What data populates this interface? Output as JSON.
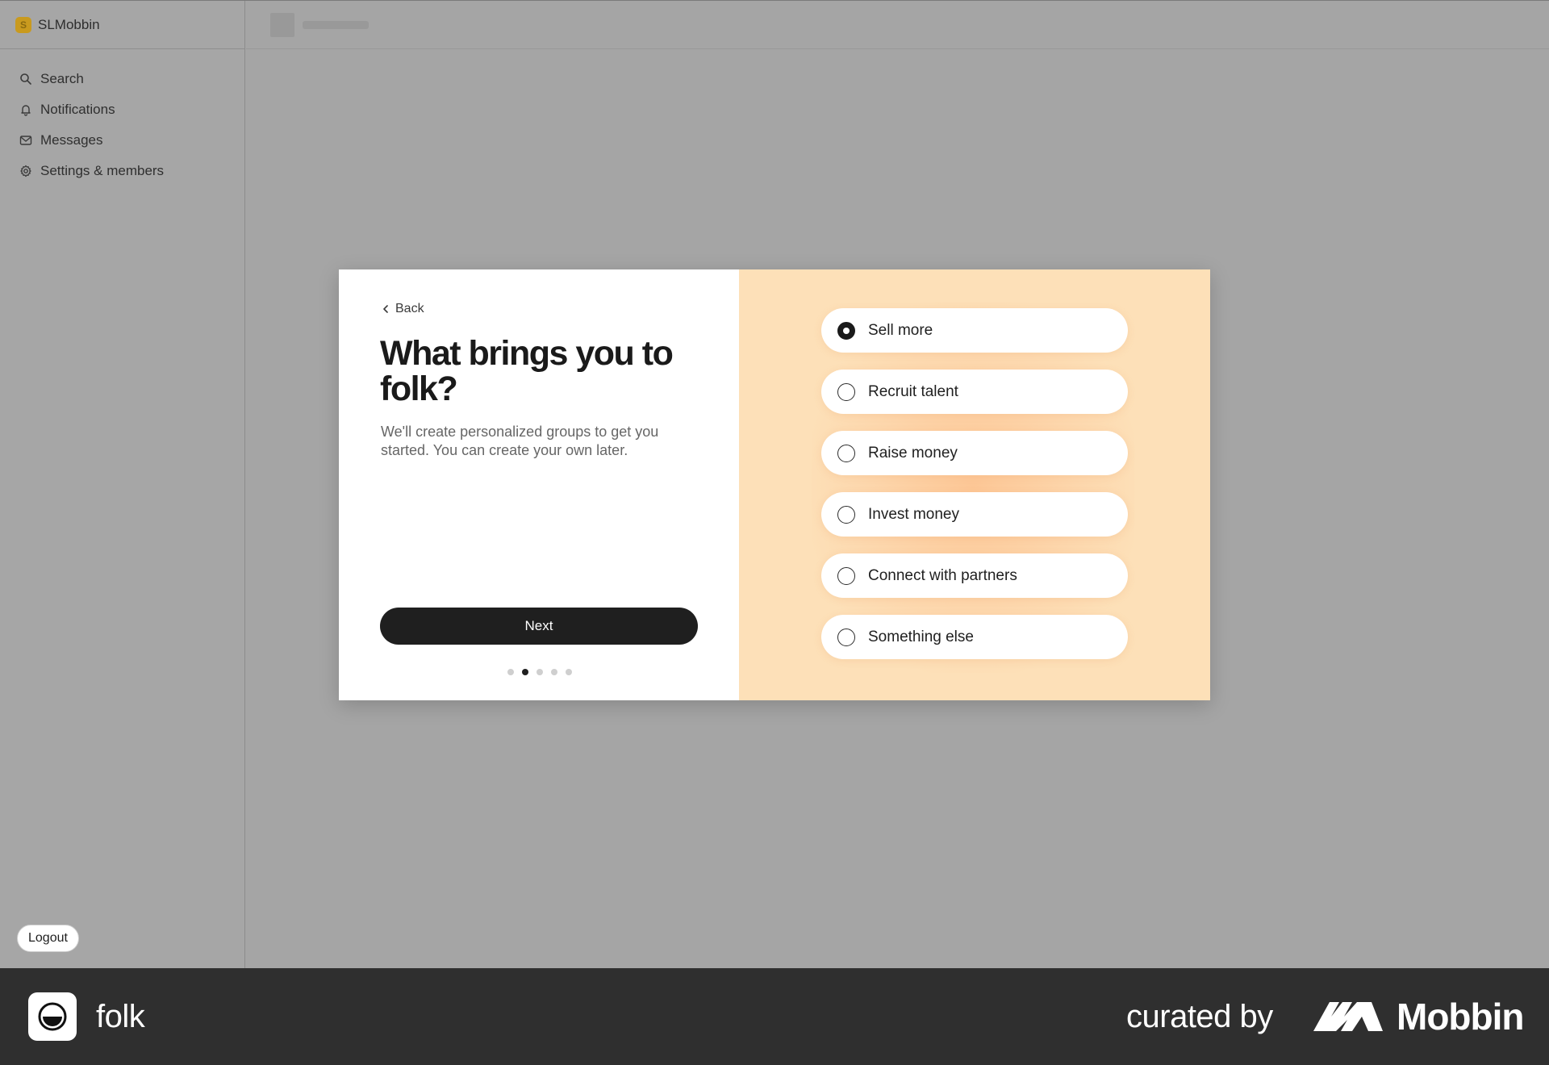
{
  "workspace": {
    "name": "SLMobbin",
    "logo_letter": "S",
    "logo_color": "#c99a1e"
  },
  "sidebar": {
    "items": [
      {
        "label": "Search",
        "icon": "search-icon"
      },
      {
        "label": "Notifications",
        "icon": "bell-icon"
      },
      {
        "label": "Messages",
        "icon": "mail-icon"
      },
      {
        "label": "Settings & members",
        "icon": "gear-icon"
      }
    ],
    "logout_label": "Logout"
  },
  "onboarding": {
    "back_label": "Back",
    "title": "What brings you to folk?",
    "subtitle": "We'll create personalized groups to get you started. You can create your own later.",
    "next_label": "Next",
    "step_current": 2,
    "step_total": 5,
    "options": [
      {
        "label": "Sell more",
        "selected": true
      },
      {
        "label": "Recruit talent",
        "selected": false
      },
      {
        "label": "Raise money",
        "selected": false
      },
      {
        "label": "Invest money",
        "selected": false
      },
      {
        "label": "Connect with partners",
        "selected": false
      },
      {
        "label": "Something else",
        "selected": false
      }
    ],
    "accent_panel_color": "#fde0b8"
  },
  "footer": {
    "app_name": "folk",
    "curated_text": "curated by",
    "brand_name": "Mobbin"
  }
}
